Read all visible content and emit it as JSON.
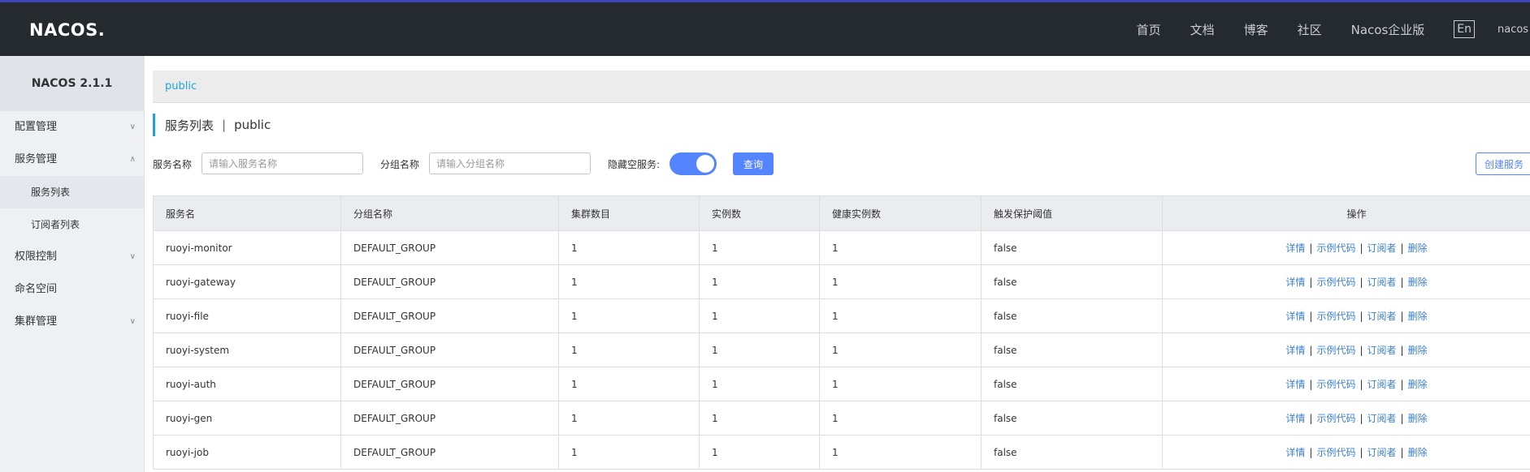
{
  "header": {
    "logo": "NACOS.",
    "nav": [
      "首页",
      "文档",
      "博客",
      "社区",
      "Nacos企业版"
    ],
    "lang": "En",
    "user": "nacos"
  },
  "sidebar": {
    "title": "NACOS 2.1.1",
    "items": [
      {
        "label": "配置管理",
        "chevron": "down"
      },
      {
        "label": "服务管理",
        "chevron": "up"
      },
      {
        "label": "服务列表",
        "sub": true,
        "active": true
      },
      {
        "label": "订阅者列表",
        "sub": true
      },
      {
        "label": "权限控制",
        "chevron": "down"
      },
      {
        "label": "命名空间"
      },
      {
        "label": "集群管理",
        "chevron": "down"
      }
    ]
  },
  "namespace": {
    "tab": "public"
  },
  "page_title": {
    "main": "服务列表",
    "separator": "|",
    "namespace": "public"
  },
  "filters": {
    "service_name_label": "服务名称",
    "service_name_placeholder": "请输入服务名称",
    "group_name_label": "分组名称",
    "group_name_placeholder": "请输入分组名称",
    "hide_empty_label": "隐藏空服务:",
    "hide_empty_on": true,
    "query_button": "查询",
    "create_button": "创建服务"
  },
  "table": {
    "columns": [
      "服务名",
      "分组名称",
      "集群数目",
      "实例数",
      "健康实例数",
      "触发保护阈值",
      "操作"
    ],
    "actions": [
      "详情",
      "示例代码",
      "订阅者",
      "删除"
    ],
    "rows": [
      [
        "ruoyi-monitor",
        "DEFAULT_GROUP",
        "1",
        "1",
        "1",
        "false"
      ],
      [
        "ruoyi-gateway",
        "DEFAULT_GROUP",
        "1",
        "1",
        "1",
        "false"
      ],
      [
        "ruoyi-file",
        "DEFAULT_GROUP",
        "1",
        "1",
        "1",
        "false"
      ],
      [
        "ruoyi-system",
        "DEFAULT_GROUP",
        "1",
        "1",
        "1",
        "false"
      ],
      [
        "ruoyi-auth",
        "DEFAULT_GROUP",
        "1",
        "1",
        "1",
        "false"
      ],
      [
        "ruoyi-gen",
        "DEFAULT_GROUP",
        "1",
        "1",
        "1",
        "false"
      ],
      [
        "ruoyi-job",
        "DEFAULT_GROUP",
        "1",
        "1",
        "1",
        "false"
      ]
    ]
  },
  "colors": {
    "header_bg": "#252a2f",
    "accent": "#21a5d6",
    "primary": "#5584ff",
    "link": "#3b7fd4"
  }
}
